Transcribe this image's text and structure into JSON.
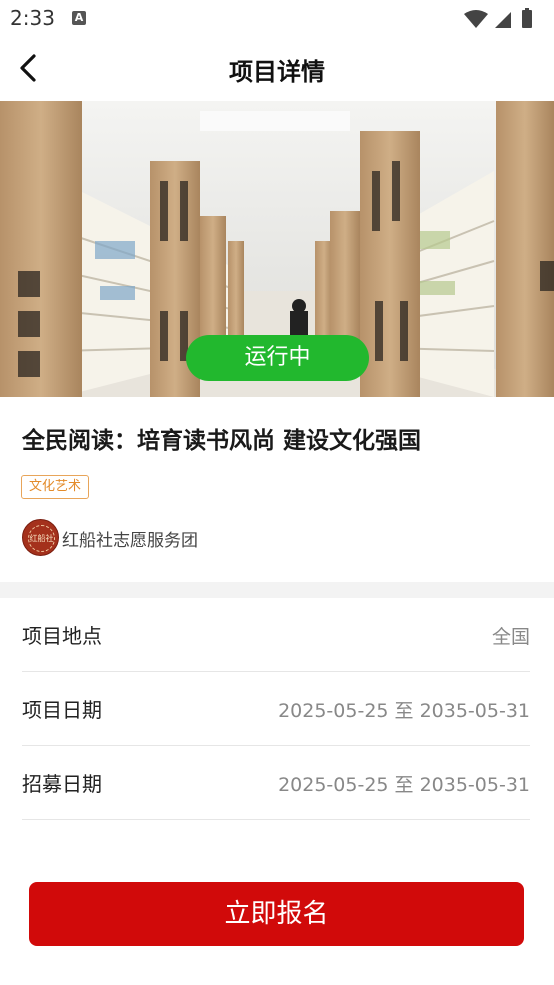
{
  "status_bar": {
    "time": "2:33",
    "notif_glyph": "A"
  },
  "header": {
    "title": "项目详情"
  },
  "banner": {
    "status_label": "运行中"
  },
  "project": {
    "title": "全民阅读：培育读书风尚 建设文化强国",
    "tag": "文化艺术",
    "org_name": "红船社志愿服务团",
    "org_avatar_text": "红船社"
  },
  "details": [
    {
      "label": "项目地点",
      "value": "全国"
    },
    {
      "label": "项目日期",
      "value": "2025-05-25 至 2035-05-31"
    },
    {
      "label": "招募日期",
      "value": "2025-05-25 至 2035-05-31"
    }
  ],
  "bottom": {
    "signup_label": "立即报名"
  },
  "colors": {
    "accent_red": "#d10a0a",
    "status_green": "#22b82e",
    "tag_orange": "#e38b2a"
  },
  "icons": {
    "back": "back-arrow-icon",
    "wifi": "wifi-icon",
    "signal": "signal-icon",
    "battery": "battery-icon"
  }
}
